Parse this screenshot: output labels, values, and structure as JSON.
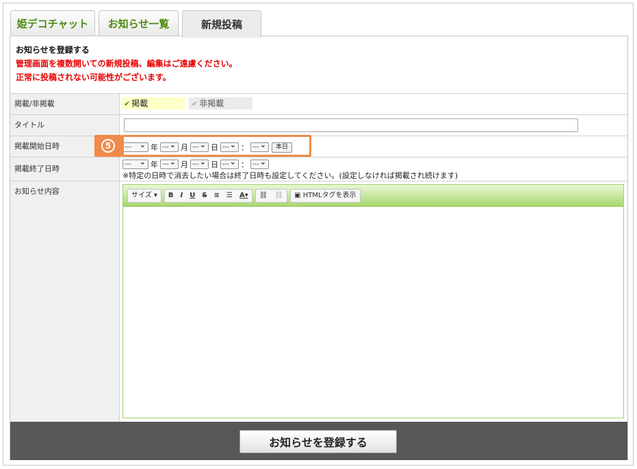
{
  "tabs": [
    {
      "label": "姫デコチャット"
    },
    {
      "label": "お知らせ一覧"
    },
    {
      "label": "新規投稿"
    }
  ],
  "intro": {
    "title": "お知らせを登録する",
    "warning1": "管理画面を複数開いての新規投稿、編集はご遠慮ください。",
    "warning2": "正常に投稿されない可能性がございます。"
  },
  "form": {
    "visibility": {
      "label": "掲載/非掲載",
      "on_label": "掲載",
      "off_label": "非掲載",
      "selected": "掲載"
    },
    "title": {
      "label": "タイトル",
      "value": ""
    },
    "start": {
      "label": "掲載開始日時",
      "placeholder": "---",
      "year_unit": "年",
      "month_unit": "月",
      "day_unit": "日",
      "colon": "：",
      "today_button": "本日"
    },
    "end": {
      "label": "掲載終了日時",
      "placeholder": "---",
      "year_unit": "年",
      "month_unit": "月",
      "day_unit": "日",
      "colon": "：",
      "note": "※特定の日時で消去したい場合は終了日時も設定してください。(設定しなければ掲載され続けます)"
    },
    "content": {
      "label": "お知らせ内容",
      "toolbar": {
        "size": "サイズ ▾",
        "bold": "B",
        "italic": "I",
        "underline": "U",
        "strike": "S",
        "align_center": "≡",
        "align_justify": "☰",
        "font_color": "A▾",
        "link": "⛓",
        "unlink": "⛓",
        "html": "HTMLタグを表示"
      },
      "value": ""
    }
  },
  "annotation": {
    "step": "5"
  },
  "submit_label": "お知らせを登録する",
  "colors": {
    "tab_green": "#4f8a10",
    "warning": "#e60000",
    "highlight": "#f08a4b",
    "editor_green": "#a8d86e",
    "footer": "#575757"
  }
}
